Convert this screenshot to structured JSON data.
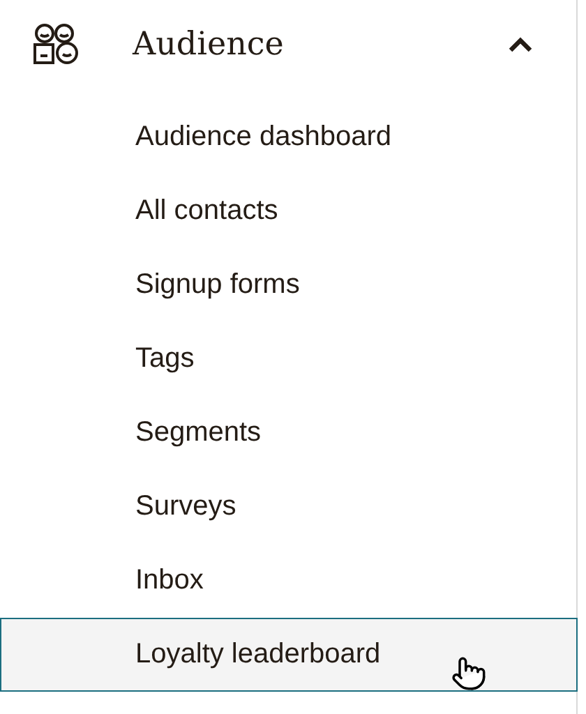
{
  "section": {
    "title": "Audience",
    "expanded": true
  },
  "items": [
    {
      "label": "Audience dashboard",
      "hovered": false
    },
    {
      "label": "All contacts",
      "hovered": false
    },
    {
      "label": "Signup forms",
      "hovered": false
    },
    {
      "label": "Tags",
      "hovered": false
    },
    {
      "label": "Segments",
      "hovered": false
    },
    {
      "label": "Surveys",
      "hovered": false
    },
    {
      "label": "Inbox",
      "hovered": false
    },
    {
      "label": "Loyalty leaderboard",
      "hovered": true
    }
  ]
}
